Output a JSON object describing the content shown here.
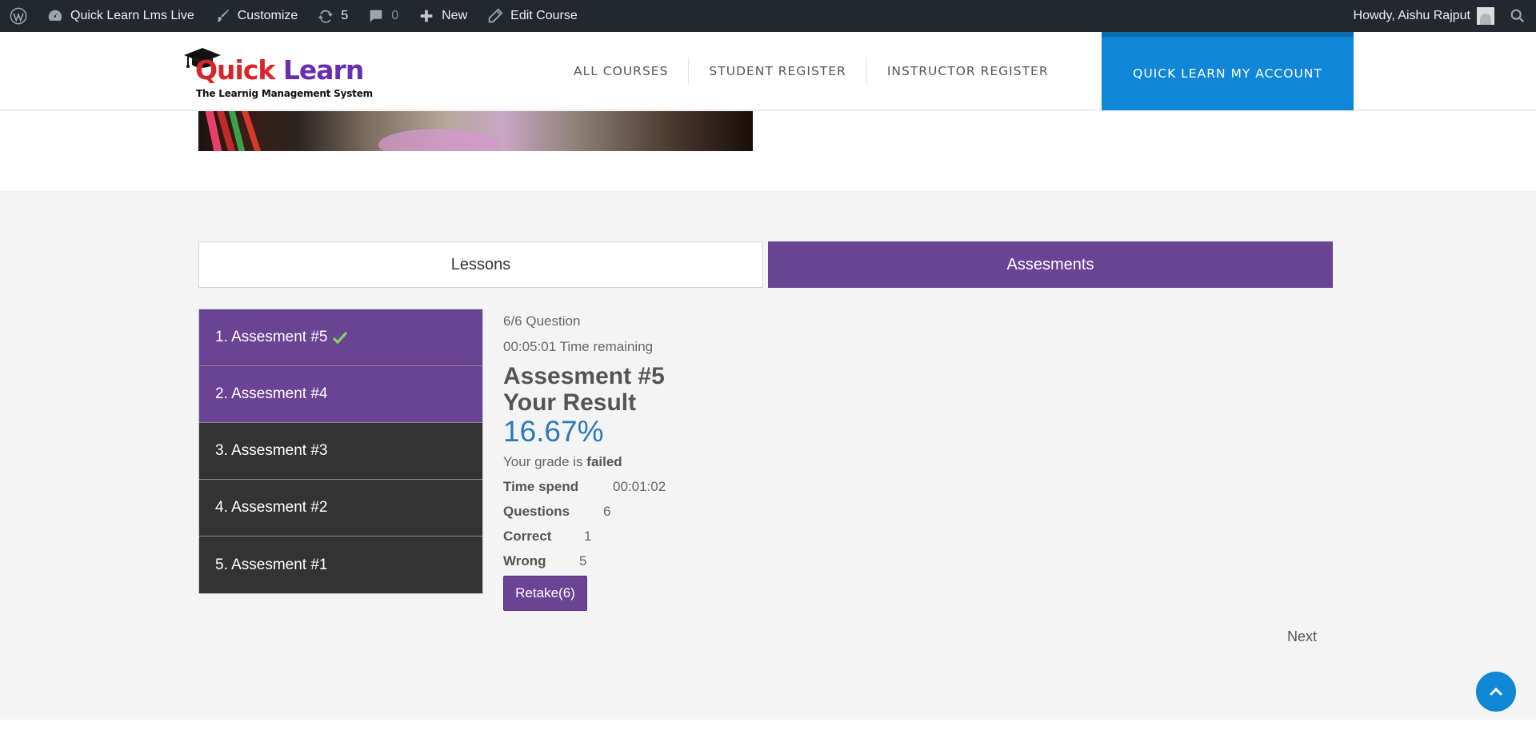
{
  "adminbar": {
    "site_name": "Quick Learn Lms Live",
    "customize": "Customize",
    "updates_count": "5",
    "comments_count": "0",
    "new_label": "New",
    "edit_label": "Edit Course",
    "howdy": "Howdy, Aishu Rajput"
  },
  "header": {
    "logo_word1": "Quick",
    "logo_word2": " Learn",
    "logo_tagline": "The Learnig Management System",
    "nav": [
      "ALL COURSES",
      "STUDENT REGISTER",
      "INSTRUCTOR REGISTER"
    ],
    "cta": "QUICK LEARN MY ACCOUNT"
  },
  "tabs": {
    "lessons": "Lessons",
    "assessments": "Assesments"
  },
  "assessments": [
    {
      "label": "1. Assesment #5",
      "completed": true
    },
    {
      "label": "2. Assesment #4",
      "completed": false
    },
    {
      "label": "3. Assesment #3",
      "completed": false
    },
    {
      "label": "4. Assesment #2",
      "completed": false
    },
    {
      "label": "5. Assesment #1",
      "completed": false
    }
  ],
  "result": {
    "question_progress": "6/6 Question",
    "time_remaining": "00:05:01 Time remaining",
    "assessment_title": "Assesment #5",
    "result_title": "Your Result",
    "percent": "16.67%",
    "grade_prefix": "Your grade is ",
    "grade": "failed",
    "time_spend_label": "Time spend",
    "time_spend_value": "00:01:02",
    "questions_label": "Questions",
    "questions_value": "6",
    "correct_label": "Correct",
    "correct_value": "1",
    "wrong_label": "Wrong",
    "wrong_value": "5",
    "retake_label": "Retake(6)"
  },
  "pagination": {
    "next": "Next"
  },
  "colors": {
    "brand_purple": "#6b4394",
    "brand_blue": "#0f86d6",
    "admin_bar": "#23282d",
    "percent_blue": "#2a7ab8"
  }
}
